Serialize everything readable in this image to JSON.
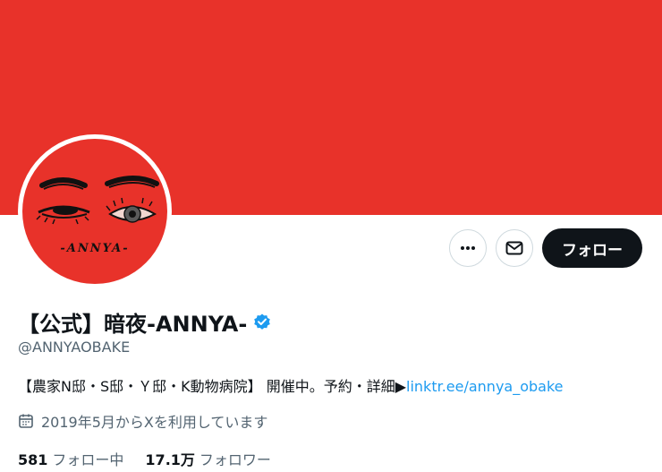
{
  "colors": {
    "banner": "#e8322a",
    "accent_link": "#1d9bf0",
    "verified": "#1d9bf0",
    "follow_button_bg": "#0f1419"
  },
  "avatar": {
    "logo_text": "-ANNYA-"
  },
  "actions": {
    "more_icon": "more-dots-icon",
    "message_icon": "mail-icon",
    "follow_label": "フォロー"
  },
  "profile": {
    "display_name": "【公式】暗夜-ANNYA-",
    "verified_icon": "verified-badge-icon",
    "handle": "@ANNYAOBAKE",
    "bio_text": "【農家N邸・S邸・Ｙ邸・K動物病院】 開催中。予約・詳細▶",
    "bio_link": "linktr.ee/annya_obake",
    "joined_icon": "calendar-icon",
    "joined_text": "2019年5月からXを利用しています"
  },
  "stats": {
    "following_count": "581",
    "following_label": "フォロー中",
    "followers_count": "17.1万",
    "followers_label": "フォロワー"
  }
}
